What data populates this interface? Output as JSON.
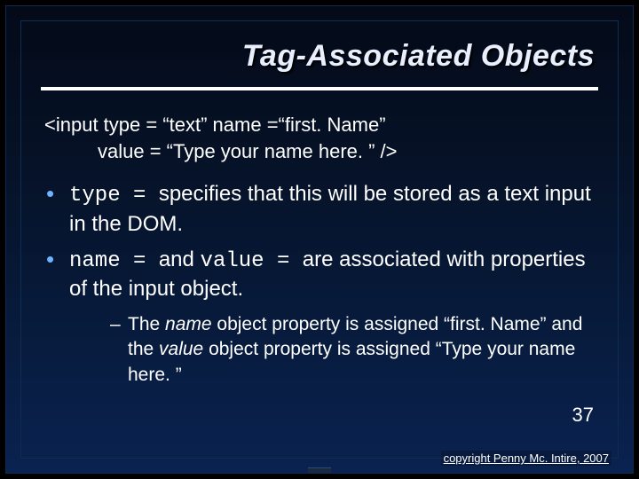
{
  "title": "Tag-Associated Objects",
  "code": {
    "line1": "<input  type = “text”  name =“first. Name”",
    "line2": "value = “Type your name here. ” />"
  },
  "bullets": [
    {
      "prefix": "type = ",
      "rest": "specifies that this will be stored as a text input in the DOM."
    },
    {
      "prefix": "name = ",
      "mid": "and ",
      "prefix2": "value = ",
      "rest": "are associated with properties of the input object."
    }
  ],
  "sub": {
    "t1": "The ",
    "i1": "name",
    "t2": " object property is assigned “first. Name” and the ",
    "i2": "value",
    "t3": " object property is assigned “Type your name here. ”"
  },
  "slidenum": "37",
  "copyright": "copyright Penny Mc. Intire, 2007"
}
